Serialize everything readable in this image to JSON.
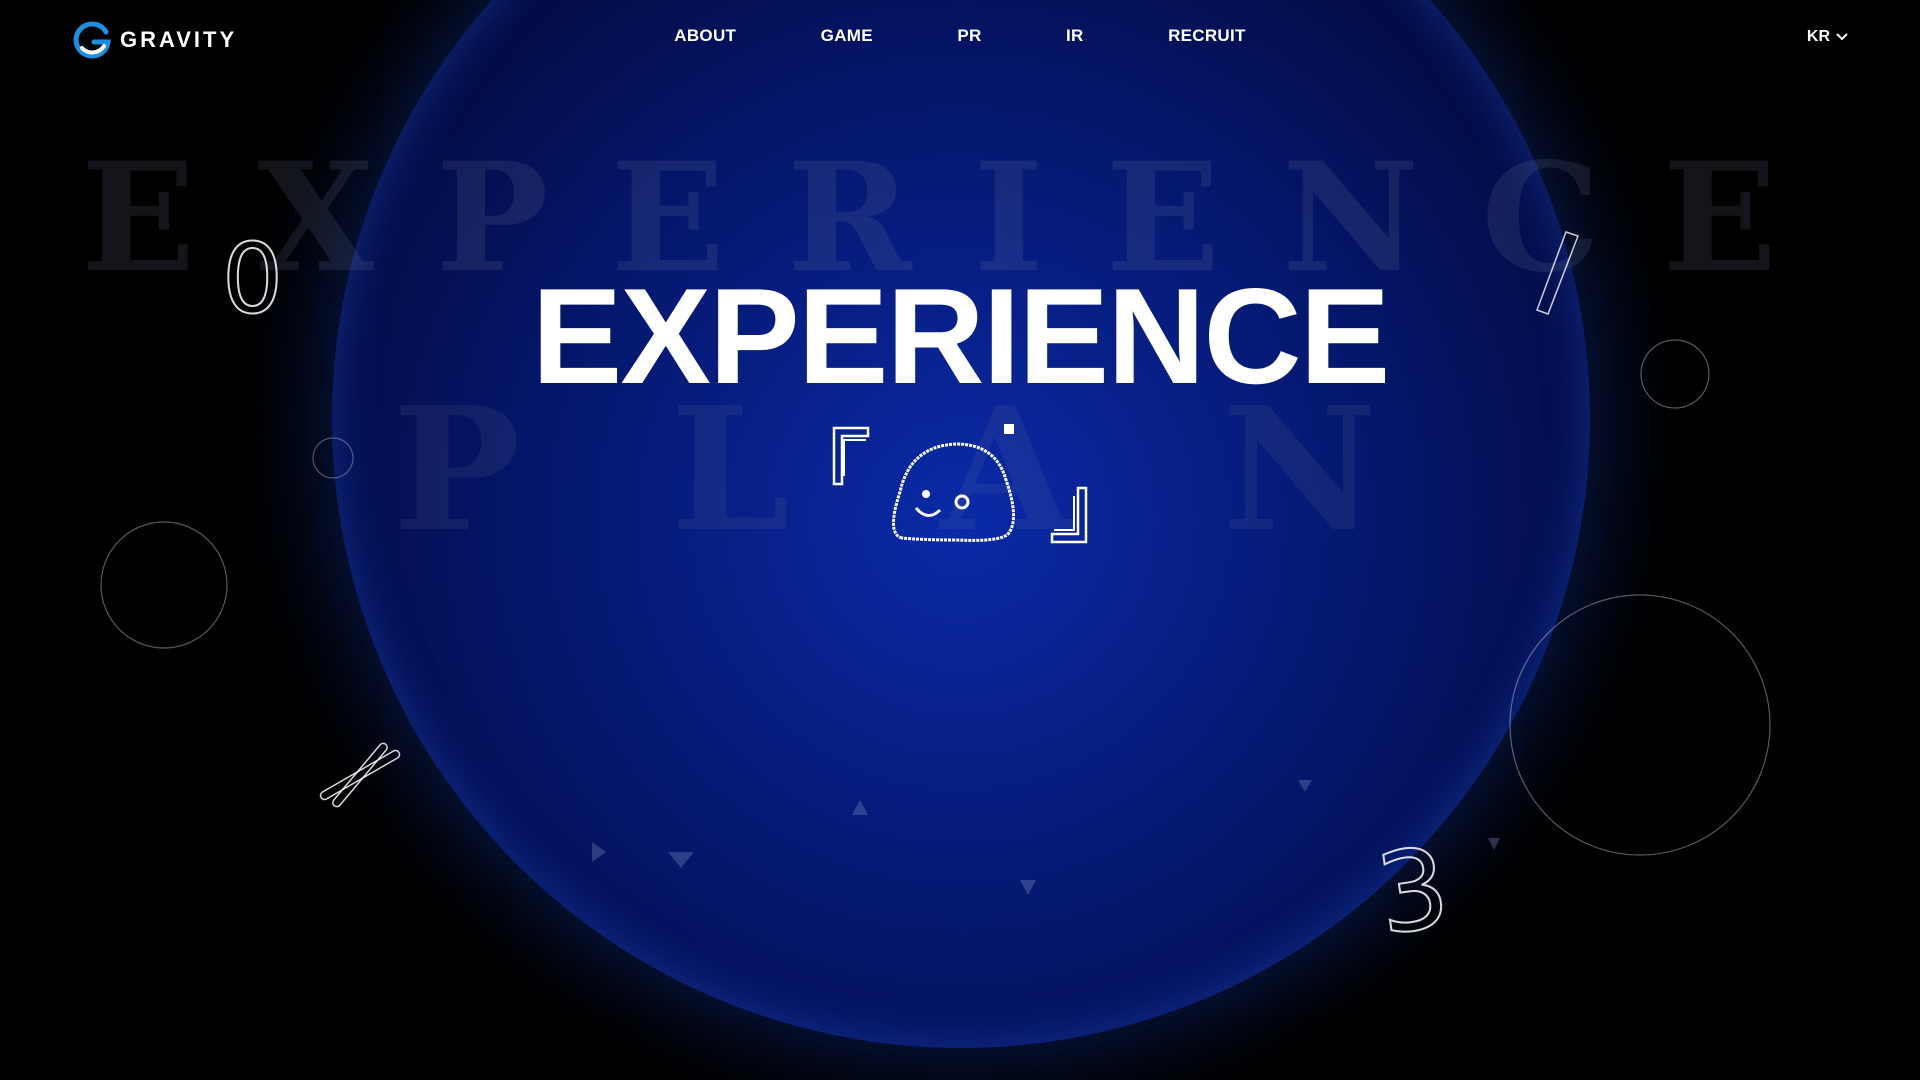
{
  "header": {
    "logo_text": "GRAVITY",
    "nav": [
      "ABOUT",
      "GAME",
      "PR",
      "IR",
      "RECRUIT"
    ],
    "language": "KR"
  },
  "hero": {
    "title": "EXPERIENCE",
    "ghost_text_top": "EXPERIENCE",
    "ghost_text_bottom": "PLAN"
  },
  "decorations": {
    "outline_digits": [
      "0",
      "3"
    ]
  },
  "colors": {
    "background": "#000000",
    "orb_core": "#0a2aa8",
    "text": "#ffffff",
    "logo_accent": "#1e8fe0"
  },
  "icons": [
    "gravity-logo-icon",
    "chevron-down-icon",
    "mascot-icon",
    "close-icon"
  ]
}
